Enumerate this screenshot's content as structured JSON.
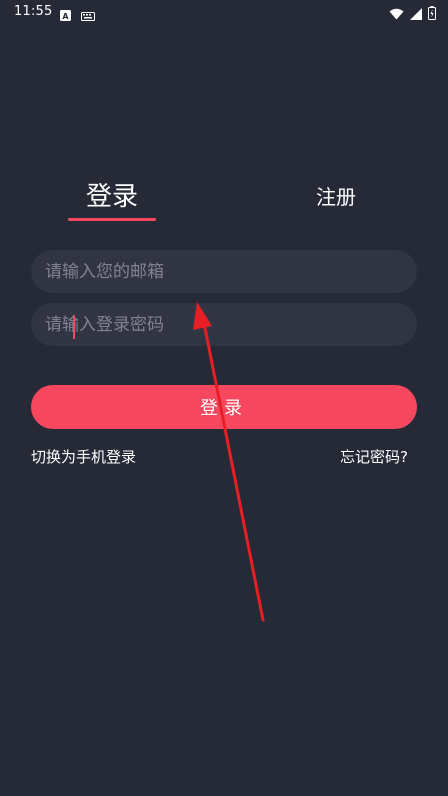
{
  "status_bar": {
    "time": "11:55",
    "icons_left": [
      "a-icon",
      "keyboard-icon"
    ],
    "icons_right": [
      "wifi-icon",
      "signal-icon",
      "battery-icon"
    ]
  },
  "tabs": {
    "login_label": "登录",
    "register_label": "注册",
    "active": "login"
  },
  "form": {
    "email_placeholder": "请输入您的邮箱",
    "email_value": "",
    "password_placeholder": "请输入登录密码",
    "password_value": "",
    "submit_label": "登录"
  },
  "links": {
    "switch_phone_login": "切换为手机登录",
    "forgot_password": "忘记密码?"
  },
  "colors": {
    "background": "#262a37",
    "input_bg": "#313543",
    "accent": "#f6475f",
    "arrow": "#e81e25"
  }
}
